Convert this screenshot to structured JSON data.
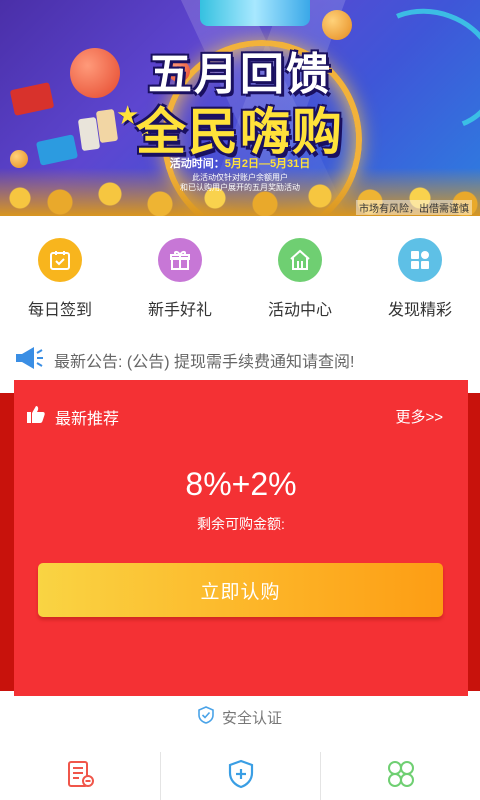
{
  "banner": {
    "headline": "五月回馈",
    "subheadline": "全民嗨购",
    "time_label": "活动时间：",
    "date_range": "5月2日—5月31日",
    "note_line1": "此活动仅针对账户余额用户",
    "note_line2": "和已认购用户展开的五月奖励活动",
    "risk_text": "市场有风险，出借需谨慎"
  },
  "menu": [
    {
      "label": "每日签到",
      "icon": "calendar-check-icon",
      "color": "#f8b51d"
    },
    {
      "label": "新手好礼",
      "icon": "gift-icon",
      "color": "#c777d6"
    },
    {
      "label": "活动中心",
      "icon": "home-activity-icon",
      "color": "#6fcf72"
    },
    {
      "label": "发现精彩",
      "icon": "discover-grid-icon",
      "color": "#5ec0e6"
    }
  ],
  "notice": {
    "icon": "megaphone-icon",
    "text": "最新公告: (公告) 提现需手续费通知请查阅!"
  },
  "recommend": {
    "title": "最新推荐",
    "more": "更多>>",
    "rate": "8%+2%",
    "remain_label": "剩余可购金额:",
    "button": "立即认购",
    "card_color": "#f43134",
    "button_color_start": "#f9d443",
    "button_color_end": "#fd9d14"
  },
  "security": {
    "icon": "shield-check-icon",
    "text": "安全认证"
  },
  "bottom_icons": [
    {
      "icon": "document-list-icon",
      "color": "#f0564a"
    },
    {
      "icon": "shield-plus-icon",
      "color": "#3a9ee4"
    },
    {
      "icon": "clover-icon",
      "color": "#6fcf72"
    }
  ]
}
